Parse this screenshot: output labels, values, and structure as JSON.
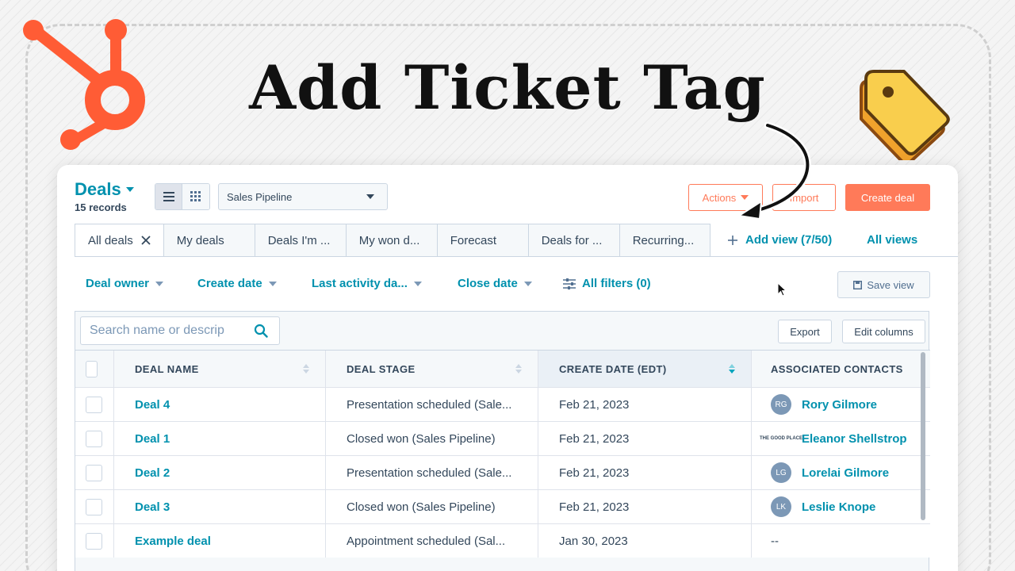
{
  "headline": "Add Ticket Tag",
  "colors": {
    "hubspot_orange": "#ff7a59",
    "link_teal": "#0091ae",
    "tag_yellow": "#f9ce4d",
    "tag_orange": "#f0a22c"
  },
  "icons": {
    "brand": "hubspot-sprocket-icon",
    "tag": "tag-icon",
    "annotation": "curved-arrow-icon"
  },
  "header": {
    "title": "Deals",
    "records": "15 records",
    "pipeline": "Sales Pipeline",
    "actions": "Actions",
    "import": "Import",
    "create": "Create deal"
  },
  "tabs": [
    {
      "label": "All deals",
      "active": true
    },
    {
      "label": "My deals"
    },
    {
      "label": "Deals I'm ..."
    },
    {
      "label": "My won d..."
    },
    {
      "label": "Forecast"
    },
    {
      "label": "Deals for ..."
    },
    {
      "label": "Recurring..."
    }
  ],
  "add_view": "Add view (7/50)",
  "all_views": "All views",
  "filters": {
    "deal_owner": "Deal owner",
    "create_date": "Create date",
    "last_activity": "Last activity da...",
    "close_date": "Close date",
    "all_filters": "All filters (0)",
    "save_view": "Save view"
  },
  "table": {
    "search_placeholder": "Search name or descrip",
    "export": "Export",
    "edit_columns": "Edit columns",
    "columns": [
      "DEAL NAME",
      "DEAL STAGE",
      "CREATE DATE (EDT)",
      "ASSOCIATED CONTACTS"
    ],
    "sorted_column": "CREATE DATE (EDT)",
    "rows": [
      {
        "name": "Deal 4",
        "stage": "Presentation scheduled (Sale...",
        "date": "Feb 21, 2023",
        "avatar": "RG",
        "contact": "Rory Gilmore"
      },
      {
        "name": "Deal 1",
        "stage": "Closed won (Sales Pipeline)",
        "date": "Feb 21, 2023",
        "avatar": "THE GOOD PLACE",
        "contact": "Eleanor Shellstrop"
      },
      {
        "name": "Deal 2",
        "stage": "Presentation scheduled (Sale...",
        "date": "Feb 21, 2023",
        "avatar": "LG",
        "contact": "Lorelai Gilmore"
      },
      {
        "name": "Deal 3",
        "stage": "Closed won (Sales Pipeline)",
        "date": "Feb 21, 2023",
        "avatar": "LK",
        "contact": "Leslie Knope"
      },
      {
        "name": "Example deal",
        "stage": "Appointment scheduled (Sal...",
        "date": "Jan 30, 2023",
        "avatar": "",
        "contact": "--"
      }
    ]
  }
}
